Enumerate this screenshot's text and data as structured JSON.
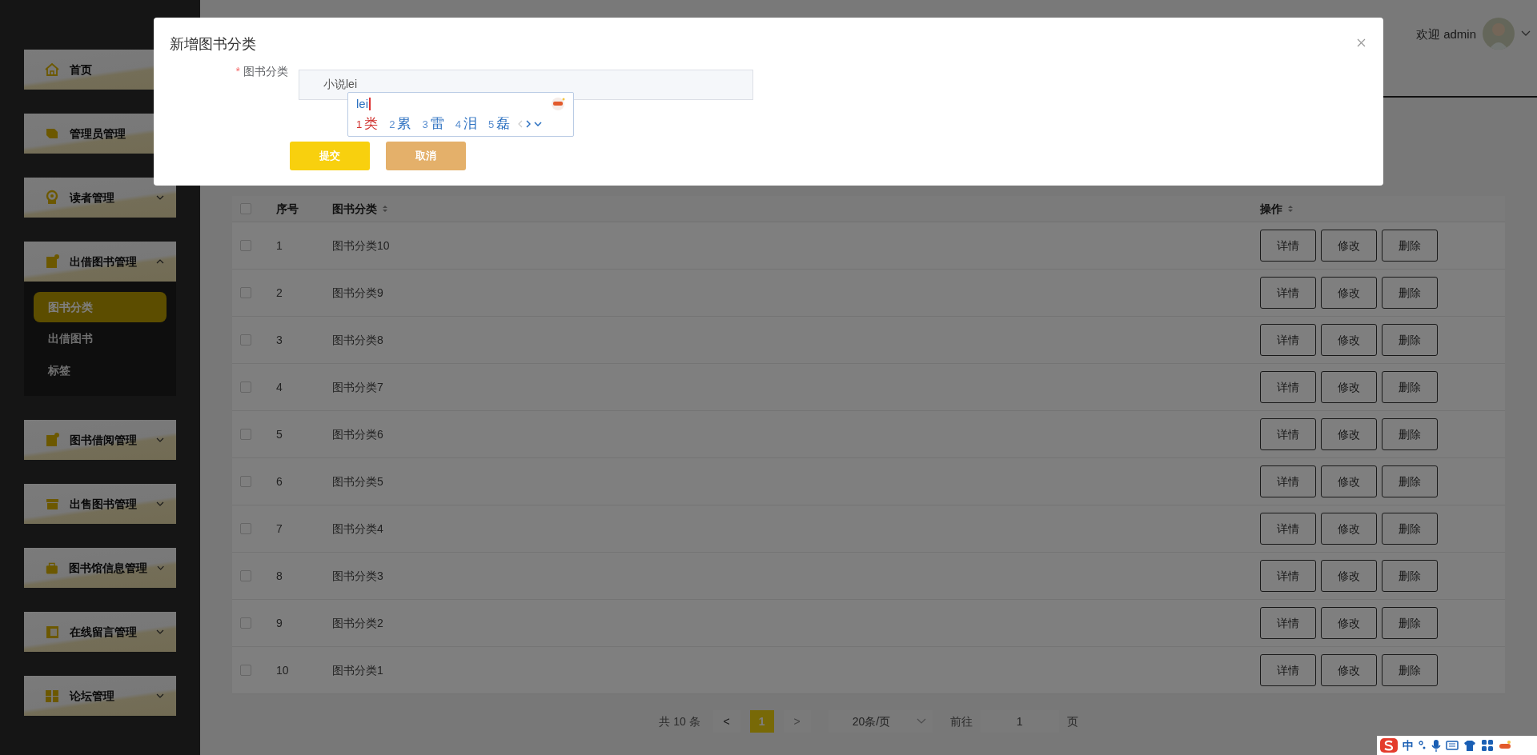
{
  "sidebar": {
    "items": [
      {
        "kind": "link",
        "label": "首页"
      },
      {
        "kind": "link",
        "label": "管理员管理"
      },
      {
        "kind": "group",
        "label": "读者管理",
        "expanded": false
      },
      {
        "kind": "group",
        "label": "出借图书管理",
        "expanded": true,
        "children": [
          {
            "label": "图书分类",
            "selected": true
          },
          {
            "label": "出借图书",
            "selected": false
          },
          {
            "label": "标签",
            "selected": false
          }
        ]
      },
      {
        "kind": "group",
        "label": "图书借阅管理",
        "expanded": false
      },
      {
        "kind": "group",
        "label": "出售图书管理",
        "expanded": false
      },
      {
        "kind": "group",
        "label": "图书馆信息管理",
        "expanded": false
      },
      {
        "kind": "group",
        "label": "在线留言管理",
        "expanded": false
      },
      {
        "kind": "group",
        "label": "论坛管理",
        "expanded": false
      }
    ]
  },
  "header": {
    "welcome": "欢迎 admin"
  },
  "table": {
    "columns": [
      "序号",
      "图书分类",
      "操作"
    ],
    "header_checked": false,
    "rows": [
      {
        "index": "1",
        "category": "图书分类10",
        "checked": false,
        "actions": [
          "详情",
          "修改",
          "删除"
        ]
      },
      {
        "index": "2",
        "category": "图书分类9",
        "checked": false,
        "actions": [
          "详情",
          "修改",
          "删除"
        ]
      },
      {
        "index": "3",
        "category": "图书分类8",
        "checked": false,
        "actions": [
          "详情",
          "修改",
          "删除"
        ]
      },
      {
        "index": "4",
        "category": "图书分类7",
        "checked": false,
        "actions": [
          "详情",
          "修改",
          "删除"
        ]
      },
      {
        "index": "5",
        "category": "图书分类6",
        "checked": false,
        "actions": [
          "详情",
          "修改",
          "删除"
        ]
      },
      {
        "index": "6",
        "category": "图书分类5",
        "checked": false,
        "actions": [
          "详情",
          "修改",
          "删除"
        ]
      },
      {
        "index": "7",
        "category": "图书分类4",
        "checked": false,
        "actions": [
          "详情",
          "修改",
          "删除"
        ]
      },
      {
        "index": "8",
        "category": "图书分类3",
        "checked": false,
        "actions": [
          "详情",
          "修改",
          "删除"
        ]
      },
      {
        "index": "9",
        "category": "图书分类2",
        "checked": false,
        "actions": [
          "详情",
          "修改",
          "删除"
        ]
      },
      {
        "index": "10",
        "category": "图书分类1",
        "checked": false,
        "actions": [
          "详情",
          "修改",
          "删除"
        ]
      }
    ]
  },
  "pagination": {
    "total": "共 10 条",
    "prev": "<",
    "pages": [
      {
        "label": "1",
        "selected": true
      }
    ],
    "next": ">",
    "page_size": "20条/页",
    "goto_label": "前往",
    "goto_value": "1",
    "goto_suffix": "页"
  },
  "dialog": {
    "title": "新增图书分类",
    "field": {
      "label": "图书分类",
      "required_mark": "*",
      "value": "小说lei"
    },
    "buttons": [
      {
        "kind": "primary",
        "label": "提交"
      },
      {
        "kind": "secondary",
        "label": "取消"
      }
    ]
  },
  "ime": {
    "composition": "lei",
    "candidates": [
      {
        "num": "1",
        "text": "类",
        "selected": true
      },
      {
        "num": "2",
        "text": "累",
        "selected": false
      },
      {
        "num": "3",
        "text": "雷",
        "selected": false
      },
      {
        "num": "4",
        "text": "泪",
        "selected": false
      },
      {
        "num": "5",
        "text": "磊",
        "selected": false
      }
    ],
    "status_bar": {
      "mode": "中"
    }
  }
}
